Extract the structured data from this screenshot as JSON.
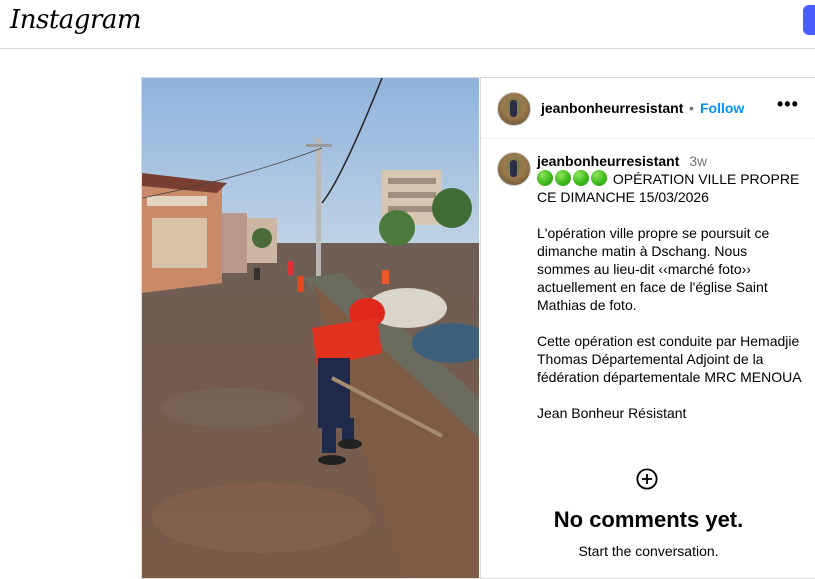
{
  "app": {
    "logo_text": "Instagram",
    "accent": "#4a5df9"
  },
  "post": {
    "username": "jeanbonheurresistant",
    "separator": "•",
    "follow_label": "Follow",
    "more_label": "•••",
    "caption": {
      "username": "jeanbonheurresistant",
      "time": "3w",
      "emoji": [
        "green-circle",
        "green-circle",
        "green-circle",
        "green-circle"
      ],
      "headline": "OPÉRATION VILLE PROPRE CE DIMANCHE 15/03/2026",
      "body": "L'opération ville propre se poursuit ce dimanche matin à Dschang. Nous sommes au lieu-dit ‹‹marché foto›› actuellement en face de l'église Saint Mathias de foto.\n\nCette opération est conduite par Hemadjie Thomas Départemental Adjoint de la fédération départementale MRC MENOUA\n\nJean Bonheur Résistant"
    },
    "comments": {
      "empty_title": "No comments yet.",
      "empty_subtitle": "Start the conversation."
    },
    "link_color": "#0095f6"
  }
}
